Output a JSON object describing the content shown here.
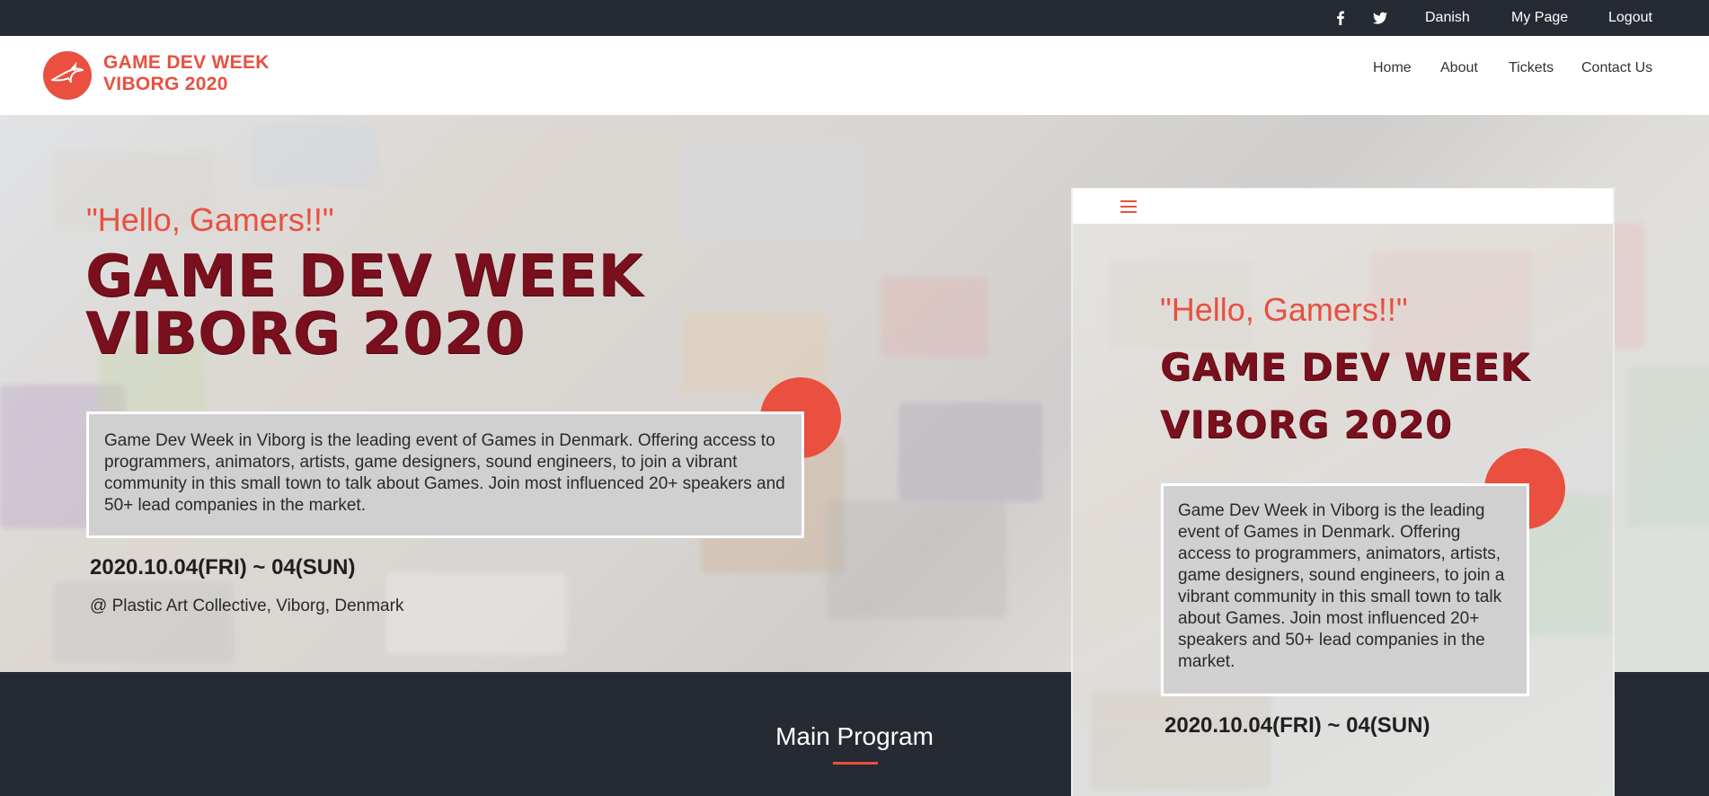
{
  "topbar": {
    "social": [
      {
        "icon": "facebook-icon"
      },
      {
        "icon": "twitter-icon"
      }
    ],
    "language": "Danish",
    "my_page": "My Page",
    "logout": "Logout"
  },
  "header": {
    "logo_line1": "GAME DEV WEEK",
    "logo_line2": "VIBORG 2020",
    "nav": [
      "Home",
      "About",
      "Tickets",
      "Contact Us"
    ]
  },
  "hero": {
    "greeting": "\"Hello, Gamers!!\"",
    "title_line1": "GAME DEV WEEK",
    "title_line2": "VIBORG 2020",
    "description": "Game Dev Week in Viborg is the leading event of Games in Denmark. Offering access to programmers, animators, artists, game designers, sound engineers, to join a vibrant community in this small town to talk about Games. Join most influenced 20+ speakers and 50+ lead companies in the market.",
    "date": "2020.10.04(FRI) ~ 04(SUN)",
    "venue": "@ Plastic Art Collective, Viborg, Denmark"
  },
  "program": {
    "title": "Main Program"
  },
  "colors": {
    "accent": "#e9503f",
    "dark": "#262a33",
    "title": "#7a0f1d"
  }
}
